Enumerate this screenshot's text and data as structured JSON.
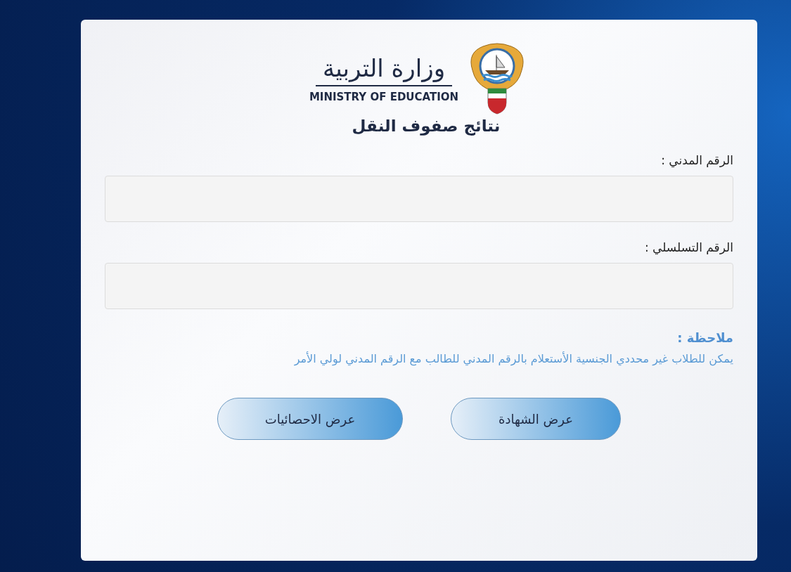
{
  "logo": {
    "arabic": "وزارة التربية",
    "english": "MINISTRY OF EDUCATION"
  },
  "title": "نتائج صفوف النقل",
  "fields": [
    {
      "label": "الرقم المدني :"
    },
    {
      "label": "الرقم التسلسلي :"
    }
  ],
  "note": {
    "heading": "ملاحظة :",
    "text": "يمكن للطلاب غير محددي الجنسية الأستعلام بالرقم المدني للطالب مع الرقم المدني لولي الأمر"
  },
  "buttons": [
    "عرض الشهادة",
    "عرض الاحصائيات"
  ]
}
